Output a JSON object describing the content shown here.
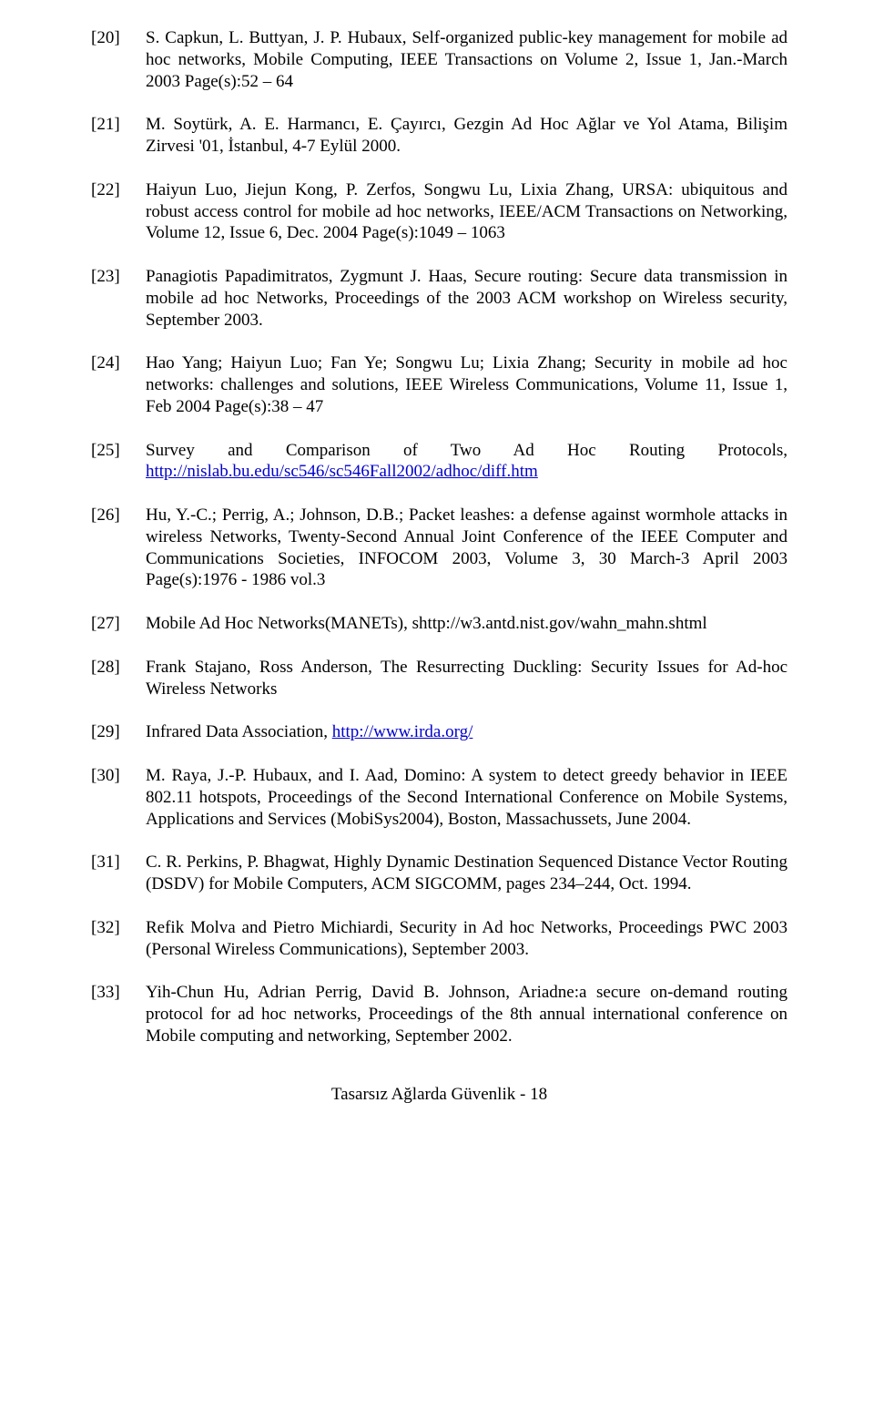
{
  "refs": [
    {
      "num": "[20]",
      "text": "S. Capkun, L. Buttyan, J. P. Hubaux, Self-organized public-key management for mobile ad hoc networks, Mobile Computing, IEEE Transactions on Volume 2,  Issue 1,  Jan.-March 2003 Page(s):52 – 64"
    },
    {
      "num": "[21]",
      "text": "M. Soytürk, A. E. Harmancı, E. Çayırcı, Gezgin Ad Hoc Ağlar ve Yol Atama, Bilişim Zirvesi '01, İstanbul,  4-7 Eylül 2000."
    },
    {
      "num": "[22]",
      "text": "Haiyun Luo, Jiejun Kong, P. Zerfos, Songwu Lu, Lixia Zhang, URSA: ubiquitous and robust access control for mobile ad hoc networks, IEEE/ACM Transactions on Networking, Volume 12,  Issue 6,  Dec. 2004 Page(s):1049 – 1063"
    },
    {
      "num": "[23]",
      "text": "Panagiotis Papadimitratos, Zygmunt J. Haas, Secure routing: Secure data transmission in mobile ad hoc Networks, Proceedings of the 2003 ACM workshop on Wireless security, September 2003."
    },
    {
      "num": "[24]",
      "text": "Hao Yang; Haiyun Luo; Fan Ye; Songwu Lu; Lixia Zhang; Security in mobile ad hoc networks: challenges and solutions, IEEE Wireless Communications, Volume 11,  Issue 1,  Feb 2004 Page(s):38 – 47"
    },
    {
      "num": "[25]",
      "pre": "Survey and Comparison of Two Ad Hoc Routing Protocols, ",
      "link": "http://nislab.bu.edu/sc546/sc546Fall2002/adhoc/diff.htm",
      "wide": true
    },
    {
      "num": "[26]",
      "text": "Hu, Y.-C.; Perrig, A.; Johnson, D.B.; Packet leashes: a defense against wormhole attacks in wireless Networks, Twenty-Second Annual Joint Conference of the IEEE Computer and Communications Societies, INFOCOM 2003, Volume 3,  30 March-3 April 2003 Page(s):1976 - 1986 vol.3"
    },
    {
      "num": "[27]",
      "text": "Mobile Ad Hoc Networks(MANETs), shttp://w3.antd.nist.gov/wahn_mahn.shtml"
    },
    {
      "num": "[28]",
      "text": "Frank Stajano, Ross Anderson, The Resurrecting Duckling: Security Issues for Ad-hoc Wireless Networks"
    },
    {
      "num": "[29]",
      "pre": "Infrared Data Association, ",
      "link": "http://www.irda.org/"
    },
    {
      "num": "[30]",
      "text": "M. Raya, J.-P. Hubaux, and I. Aad, Domino: A system to detect greedy behavior in IEEE 802.11 hotspots, Proceedings of the Second International Conference on Mobile Systems, Applications and Services (MobiSys2004), Boston, Massachussets, June 2004."
    },
    {
      "num": "[31]",
      "text": "C. R. Perkins, P. Bhagwat, Highly Dynamic Destination Sequenced Distance Vector Routing (DSDV) for Mobile Computers, ACM SIGCOMM, pages 234–244, Oct. 1994."
    },
    {
      "num": "[32]",
      "text": "Refik Molva and Pietro Michiardi, Security in Ad hoc Networks, Proceedings PWC 2003 (Personal Wireless Communications), September 2003."
    },
    {
      "num": "[33]",
      "text": "Yih-Chun Hu, Adrian Perrig, David B. Johnson, Ariadne:a secure on-demand routing protocol for ad hoc networks, Proceedings of the 8th annual international conference on Mobile computing and networking, September 2002."
    }
  ],
  "footer": "Tasarsız Ağlarda Güvenlik - 18"
}
